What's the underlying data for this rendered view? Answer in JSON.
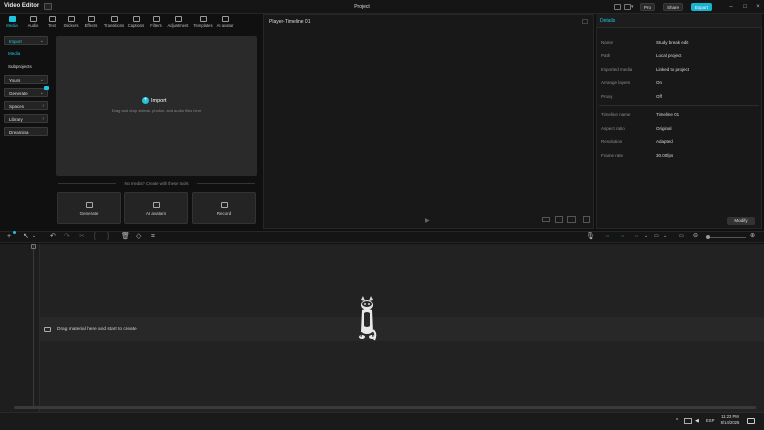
{
  "app": {
    "title": "Video Editor",
    "project_title": "Project"
  },
  "header_buttons": {
    "pro": "Pro",
    "share": "Share",
    "export": "Export"
  },
  "toolbar": {
    "tools": [
      {
        "label": "Media",
        "icon": "media-icon",
        "active": true
      },
      {
        "label": "Audio",
        "icon": "audio-icon"
      },
      {
        "label": "Text",
        "icon": "text-icon"
      },
      {
        "label": "Stickers",
        "icon": "stickers-icon"
      },
      {
        "label": "Effects",
        "icon": "effects-icon"
      },
      {
        "label": "Transitions",
        "icon": "transitions-icon"
      },
      {
        "label": "Captions",
        "icon": "captions-icon"
      },
      {
        "label": "Filters",
        "icon": "filters-icon"
      },
      {
        "label": "Adjustment",
        "icon": "adjustment-icon"
      },
      {
        "label": "Templates",
        "icon": "templates-icon"
      },
      {
        "label": "AI avatar",
        "icon": "ai-avatar-icon"
      }
    ]
  },
  "left_nav": {
    "import": "Import",
    "media": "Media",
    "subprojects": "Subprojects",
    "yours": "Yours",
    "generate": "Generate",
    "spaces": "Spaces",
    "library": "Library",
    "dreamina": "Dreamina"
  },
  "media_panel": {
    "import_label": "Import",
    "drag_hint": "Drag and drop videos, photos, and audio files here",
    "no_media": "No media? Create with these tools",
    "cards": [
      {
        "label": "Generate",
        "icon": "generate-icon"
      },
      {
        "label": "AI avatars",
        "icon": "ai-avatars-icon"
      },
      {
        "label": "Record",
        "icon": "record-icon"
      }
    ]
  },
  "player": {
    "title": "Player-Timeline 01"
  },
  "details": {
    "title": "Details",
    "rows_top": [
      {
        "label": "Name",
        "value": "Study break edit"
      },
      {
        "label": "Path",
        "value": "Local project"
      },
      {
        "label": "Imported media",
        "value": "Linked to project"
      },
      {
        "label": "Arrange layers",
        "value": "On"
      },
      {
        "label": "Proxy",
        "value": "Off"
      }
    ],
    "rows_bottom": [
      {
        "label": "Timeline name",
        "value": "Timeline 01"
      },
      {
        "label": "Aspect ratio",
        "value": "Original"
      },
      {
        "label": "Resolution",
        "value": "Adapted"
      },
      {
        "label": "Frame rate",
        "value": "30.00fps"
      }
    ],
    "modify": "Modify"
  },
  "timeline": {
    "drag_hint": "Drag material here and start to create"
  },
  "taskbar": {
    "lang": "ESP",
    "time": "11:23 PM",
    "date": "8/14/2026"
  },
  "colors": {
    "accent": "#23c3dd",
    "panel": "#2a2a2a",
    "background": "#101010"
  }
}
